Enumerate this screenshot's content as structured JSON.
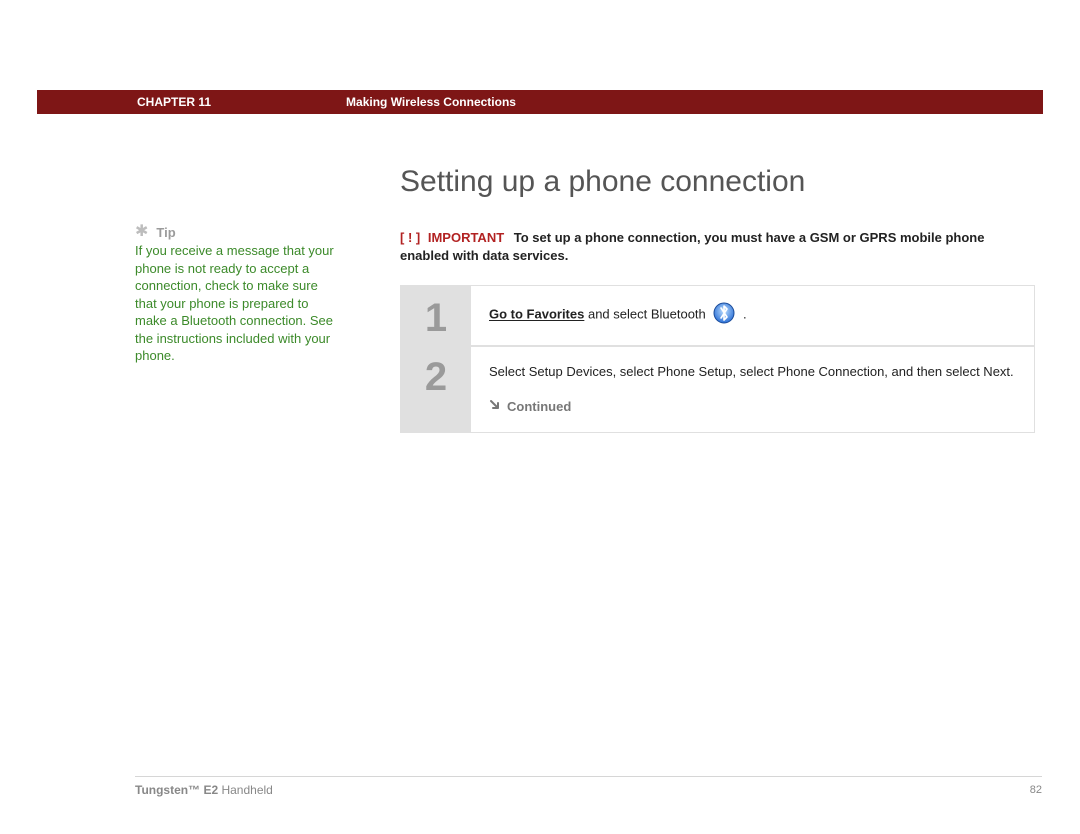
{
  "header": {
    "chapter_label": "CHAPTER 11",
    "chapter_title": "Making Wireless Connections"
  },
  "sidebar": {
    "tip_label": "Tip",
    "tip_body": "If you receive a message that your phone is not ready to accept a connection, check to make sure that your phone is prepared to make a Bluetooth connection. See the instructions included with your phone."
  },
  "main": {
    "section_title": "Setting up a phone connection",
    "important": {
      "brackets": "[ ! ]",
      "word": "IMPORTANT",
      "body": "To set up a phone connection, you must have a GSM or GPRS mobile phone enabled with data services."
    },
    "steps": [
      {
        "num": "1",
        "bold_lead": "Go to Favorites",
        "rest": " and select Bluetooth ",
        "trail": " ."
      },
      {
        "num": "2",
        "text": "Select Setup Devices, select Phone Setup, select Phone Connection, and then select Next.",
        "continued": "Continued"
      }
    ]
  },
  "footer": {
    "product_bold": "Tungsten™ E2",
    "product_rest": " Handheld",
    "page": "82"
  },
  "icons": {
    "asterisk": "✱",
    "bluetooth": "bluetooth-icon",
    "continued_arrow": "↘"
  }
}
